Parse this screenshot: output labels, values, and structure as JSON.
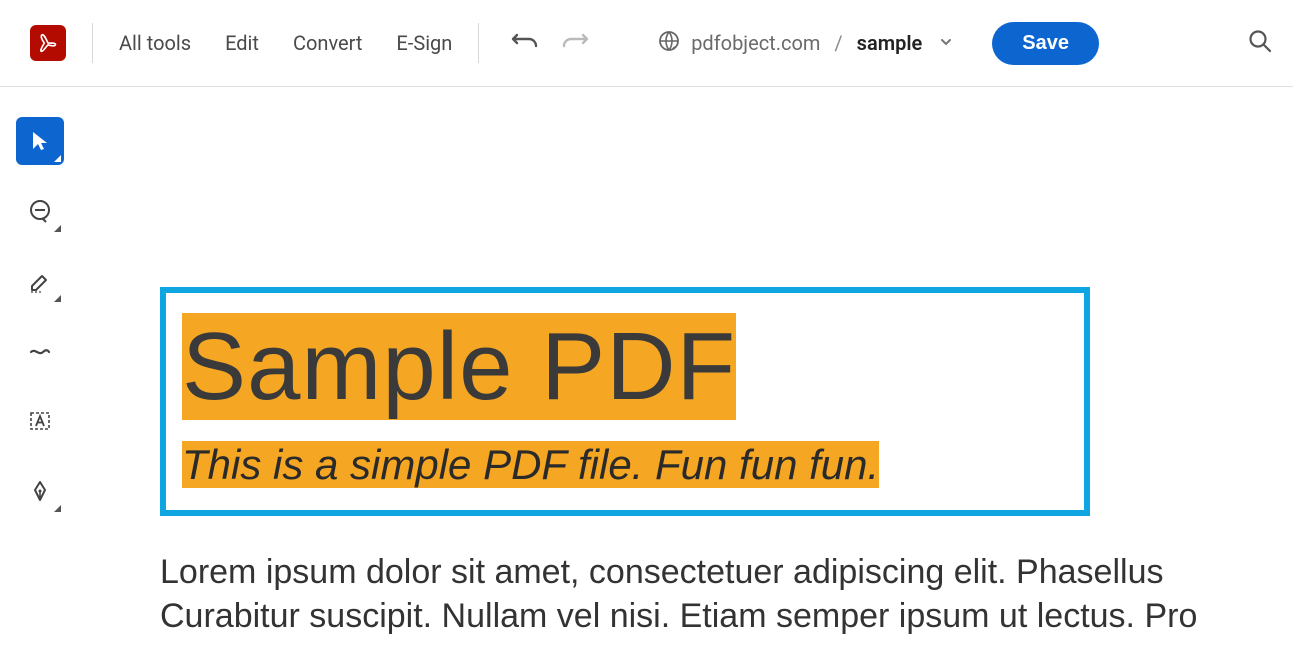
{
  "brand": {
    "logo_name": "acrobat-logo"
  },
  "menu": {
    "all_tools": "All tools",
    "edit": "Edit",
    "convert": "Convert",
    "esign": "E-Sign"
  },
  "breadcrumb": {
    "domain": "pdfobject.com",
    "separator": "/",
    "document": "sample"
  },
  "actions": {
    "save_label": "Save"
  },
  "sidebar_tools": {
    "select": "select-tool",
    "comment": "comment-tool",
    "highlight": "highlight-tool",
    "draw": "draw-tool",
    "textbox": "textbox-tool",
    "sign": "sign-tool"
  },
  "document": {
    "title": "Sample PDF",
    "subtitle": "This is a simple PDF file. Fun fun fun.",
    "body_line1": "Lorem ipsum dolor sit amet, consectetuer adipiscing elit. Phasellus ",
    "body_line2": "Curabitur suscipit. Nullam vel nisi. Etiam semper ipsum ut lectus. Pro"
  },
  "colors": {
    "brand_red": "#b30b00",
    "primary_blue": "#0d66d0",
    "selection_cyan": "#0ea5e0",
    "highlight_orange": "#f5a623"
  }
}
